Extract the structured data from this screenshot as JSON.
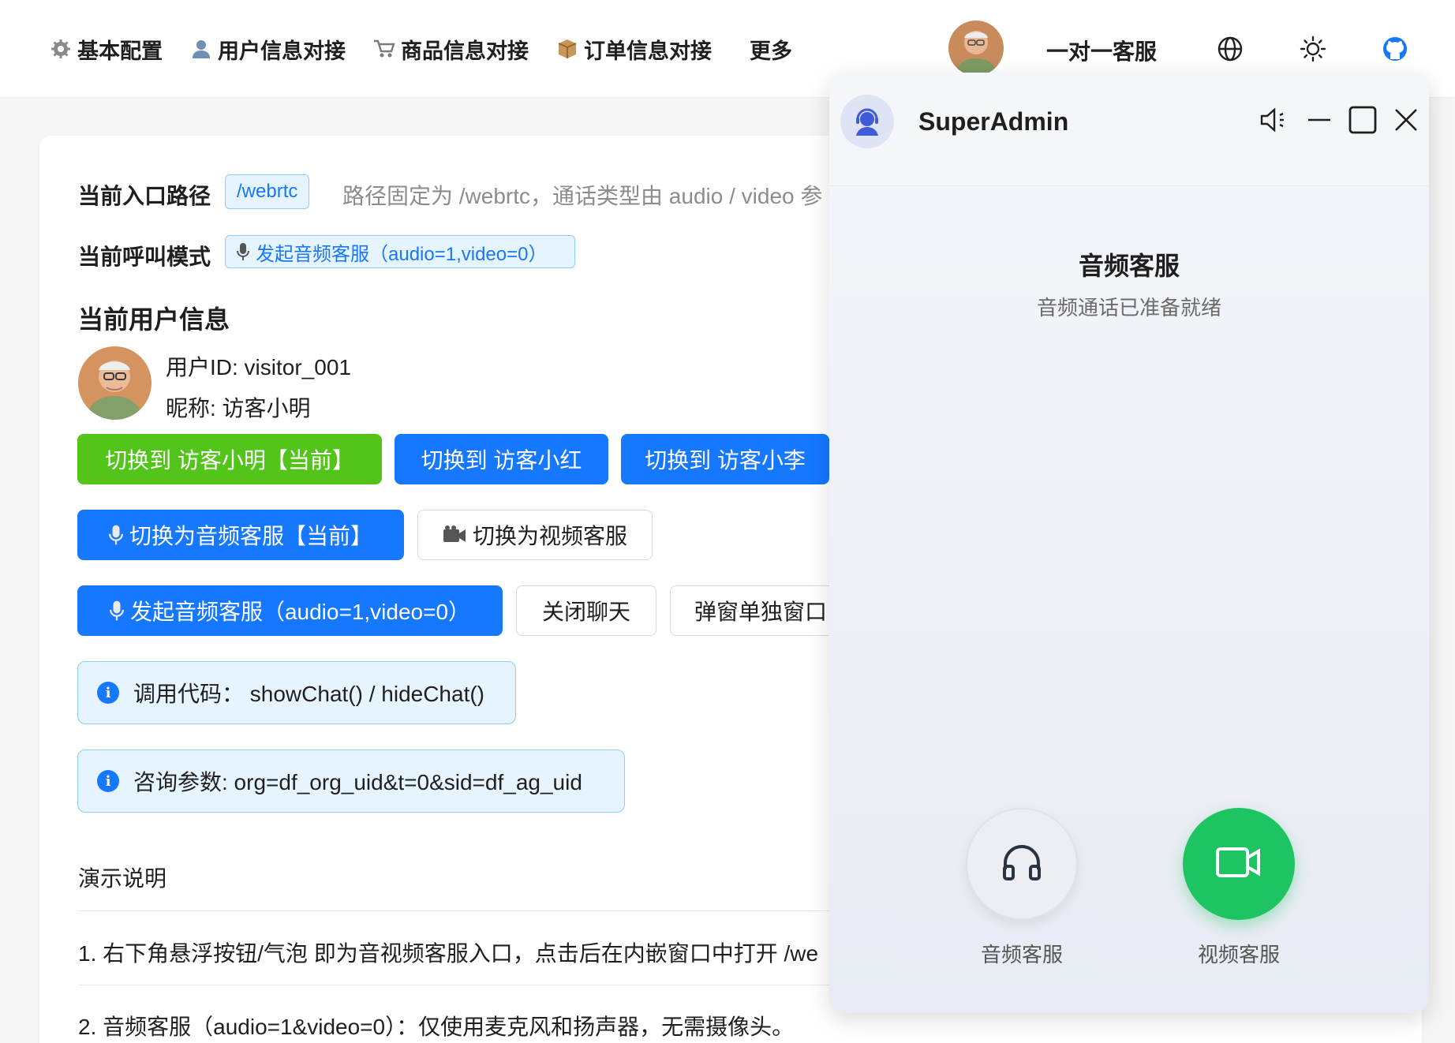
{
  "nav": {
    "items": [
      {
        "icon": "gear-icon",
        "label": "基本配置"
      },
      {
        "icon": "user-icon",
        "label": "用户信息对接"
      },
      {
        "icon": "cart-icon",
        "label": "商品信息对接"
      },
      {
        "icon": "box-icon",
        "label": "订单信息对接"
      },
      {
        "icon": "",
        "label": "更多"
      }
    ],
    "service_label": "一对一客服",
    "right_icons": [
      "globe-icon",
      "sun-icon",
      "github-icon"
    ]
  },
  "main": {
    "entry_path_label": "当前入口路径",
    "entry_path_value": "/webrtc",
    "entry_path_hint": "路径固定为 /webrtc，通话类型由 audio / video 参",
    "call_mode_label": "当前呼叫模式",
    "call_mode_value": "发起音频客服（audio=1,video=0）",
    "user_section_title": "当前用户信息",
    "user_id_line": "用户ID: visitor_001",
    "nickname_line": "昵称: 访客小明",
    "switch_user_buttons": [
      "切换到 访客小明【当前】",
      "切换到 访客小红",
      "切换到 访客小李"
    ],
    "switch_mode_buttons": [
      "切换为音频客服【当前】",
      "切换为视频客服"
    ],
    "action_buttons": [
      "发起音频客服（audio=1,video=0）",
      "关闭聊天",
      "弹窗单独窗口"
    ],
    "info_code": "调用代码：  showChat() / hideChat()",
    "info_params": "咨询参数: org=df_org_uid&t=0&sid=df_ag_uid",
    "demo_title": "演示说明",
    "demo_lines": [
      "1. 右下角悬浮按钮/气泡 即为音视频客服入口，点击后在内嵌窗口中打开 /we",
      "2. 音频客服（audio=1&video=0）：仅使用麦克风和扬声器，无需摄像头。"
    ]
  },
  "chat": {
    "agent_name": "SuperAdmin",
    "call_title": "音频客服",
    "call_subtitle": "音频通话已准备就绪",
    "audio_label": "音频客服",
    "video_label": "视频客服"
  },
  "colors": {
    "green": "#52c41a",
    "blue": "#1677ff",
    "call_green": "#1dc461",
    "tag_bg": "#e6f4ff"
  }
}
